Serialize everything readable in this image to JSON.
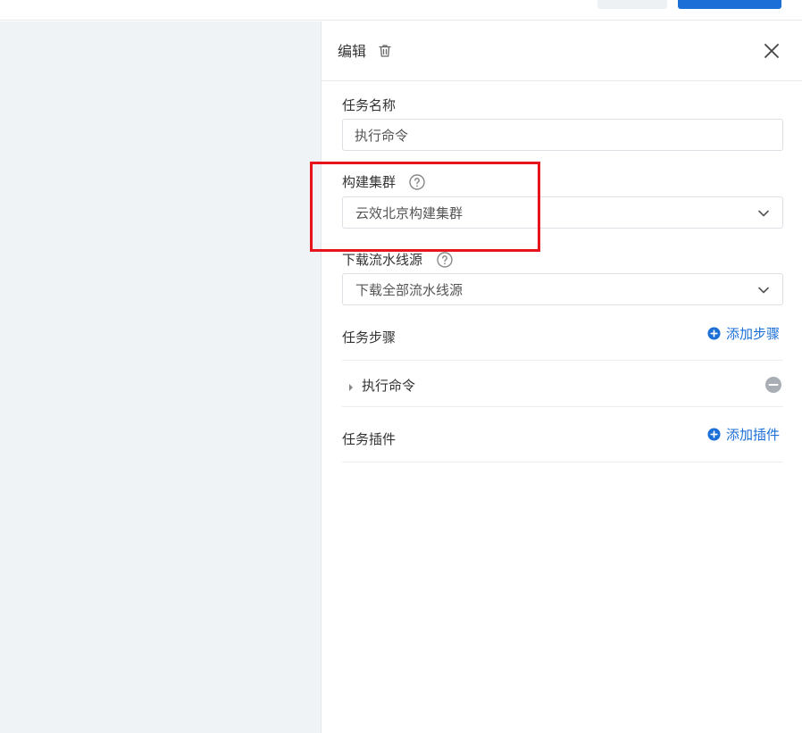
{
  "drawer": {
    "title": "编辑",
    "task_name": {
      "label": "任务名称",
      "value": "执行命令"
    },
    "build_cluster": {
      "label": "构建集群",
      "value": "云效北京构建集群"
    },
    "download_source": {
      "label": "下载流水线源",
      "value": "下载全部流水线源"
    },
    "task_steps": {
      "label": "任务步骤",
      "add_label": "添加步骤",
      "items": [
        {
          "name": "执行命令"
        }
      ]
    },
    "task_plugins": {
      "label": "任务插件",
      "add_label": "添加插件"
    }
  },
  "colors": {
    "accent": "#1b6fd6",
    "highlight": "#e8141b",
    "canvas_bg": "#f0f3f6"
  },
  "icons": [
    "trash-icon",
    "close-icon",
    "help-icon",
    "chevron-down-icon",
    "plus-circle-icon",
    "caret-right-icon",
    "minus-circle-icon"
  ]
}
